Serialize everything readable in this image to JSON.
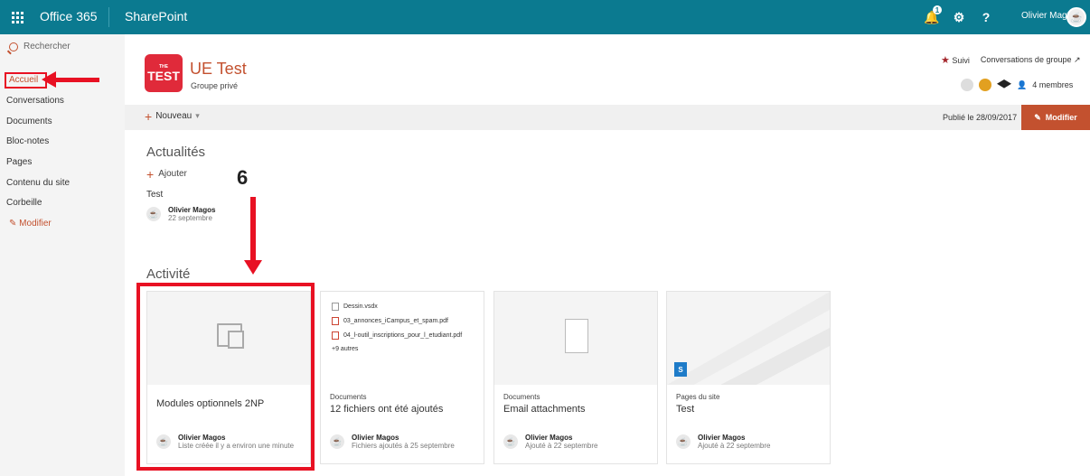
{
  "topbar": {
    "app_name": "Office 365",
    "product": "SharePoint",
    "notification_count": "1",
    "help": "?",
    "user_name": "Olivier Magos"
  },
  "leftnav": {
    "search_placeholder": "Rechercher",
    "items": [
      {
        "label": "Accueil",
        "active": true
      },
      {
        "label": "Conversations"
      },
      {
        "label": "Documents"
      },
      {
        "label": "Bloc-notes"
      },
      {
        "label": "Pages"
      },
      {
        "label": "Contenu du site"
      },
      {
        "label": "Corbeille"
      }
    ],
    "edit": "Modifier"
  },
  "site": {
    "logo_top": "THE",
    "logo_main": "TEST",
    "title": "UE Test",
    "subtitle": "Groupe privé",
    "follow": "Suivi",
    "conversations": "Conversations de groupe ↗",
    "members": "4 membres"
  },
  "cmdbar": {
    "new": "Nouveau",
    "published": "Publié le 28/09/2017",
    "edit": "Modifier"
  },
  "news": {
    "heading": "Actualités",
    "add": "Ajouter",
    "item_title": "Test",
    "author": "Olivier Magos",
    "date": "22 septembre"
  },
  "annotation": {
    "step_number": "6"
  },
  "activity": {
    "heading": "Activité",
    "cards": [
      {
        "meta": "",
        "title": "Modules optionnels 2NP",
        "author": "Olivier Magos",
        "detail": "Liste créée il y a environ une minute"
      },
      {
        "meta": "Documents",
        "title": "12 fichiers ont été ajoutés",
        "author": "Olivier Magos",
        "detail": "Fichiers ajoutés à 25 septembre",
        "files": [
          "Dessin.vsdx",
          "03_annonces_iCampus_et_spam.pdf",
          "04_l-outil_inscriptions_pour_l_etudiant.pdf"
        ],
        "more": "+9 autres"
      },
      {
        "meta": "Documents",
        "title": "Email attachments",
        "author": "Olivier Magos",
        "detail": "Ajouté à 22 septembre"
      },
      {
        "meta": "Pages du site",
        "title": "Test",
        "author": "Olivier Magos",
        "detail": "Ajouté à 22 septembre"
      }
    ]
  }
}
